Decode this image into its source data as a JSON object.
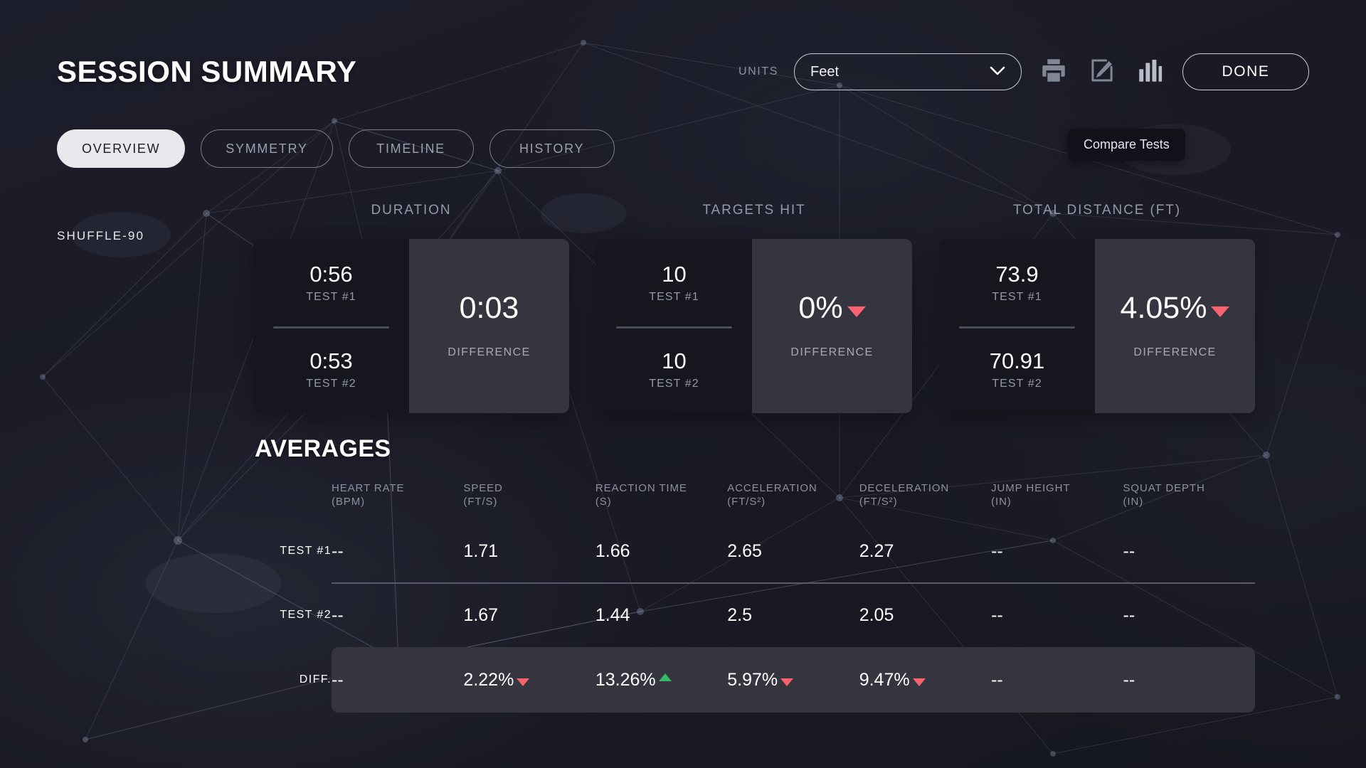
{
  "header": {
    "title": "SESSION SUMMARY",
    "units_label": "UNITS",
    "units_value": "Feet",
    "print_icon": "printer-icon",
    "edit_icon": "edit-pencil-icon",
    "chart_icon": "bar-chart-icon",
    "done_label": "DONE",
    "tooltip": "Compare Tests"
  },
  "tabs": [
    {
      "label": "OVERVIEW",
      "active": true
    },
    {
      "label": "SYMMETRY",
      "active": false
    },
    {
      "label": "TIMELINE",
      "active": false
    },
    {
      "label": "HISTORY",
      "active": false
    }
  ],
  "session": {
    "name": "SHUFFLE-90"
  },
  "cards": [
    {
      "title": "DURATION",
      "test1_value": "0:56",
      "test1_label": "TEST #1",
      "test2_value": "0:53",
      "test2_label": "TEST #2",
      "difference_value": "0:03",
      "difference_label": "DIFFERENCE",
      "trend": "none"
    },
    {
      "title": "TARGETS HIT",
      "test1_value": "10",
      "test1_label": "TEST #1",
      "test2_value": "10",
      "test2_label": "TEST #2",
      "difference_value": "0%",
      "difference_label": "DIFFERENCE",
      "trend": "down"
    },
    {
      "title": "TOTAL DISTANCE (FT)",
      "test1_value": "73.9",
      "test1_label": "TEST #1",
      "test2_value": "70.91",
      "test2_label": "TEST #2",
      "difference_value": "4.05%",
      "difference_label": "DIFFERENCE",
      "trend": "down"
    }
  ],
  "averages": {
    "title": "AVERAGES",
    "columns": [
      {
        "name": "HEART RATE",
        "unit": "(BPM)"
      },
      {
        "name": "SPEED",
        "unit": "(FT/S)"
      },
      {
        "name": "REACTION TIME",
        "unit": "(S)"
      },
      {
        "name": "ACCELERATION",
        "unit": "(FT/S²)"
      },
      {
        "name": "DECELERATION",
        "unit": "(FT/S²)"
      },
      {
        "name": "JUMP HEIGHT",
        "unit": "(IN)"
      },
      {
        "name": "SQUAT DEPTH",
        "unit": "(IN)"
      }
    ],
    "rows": [
      {
        "label": "TEST #1",
        "values": [
          "--",
          "1.71",
          "1.66",
          "2.65",
          "2.27",
          "--",
          "--"
        ],
        "trends": [
          "none",
          "none",
          "none",
          "none",
          "none",
          "none",
          "none"
        ]
      },
      {
        "label": "TEST #2",
        "values": [
          "--",
          "1.67",
          "1.44",
          "2.5",
          "2.05",
          "--",
          "--"
        ],
        "trends": [
          "none",
          "none",
          "none",
          "none",
          "none",
          "none",
          "none"
        ]
      },
      {
        "label": "DIFF.",
        "values": [
          "--",
          "2.22%",
          "13.26%",
          "5.97%",
          "9.47%",
          "--",
          "--"
        ],
        "trends": [
          "none",
          "down",
          "up",
          "down",
          "down",
          "none",
          "none"
        ]
      }
    ]
  },
  "colors": {
    "negative": "#f9626e",
    "positive": "#38b96a",
    "background": "#1b1c28",
    "card_dark": "#15161e",
    "card_light": "#34353f",
    "accent_text": "#ffffff"
  }
}
